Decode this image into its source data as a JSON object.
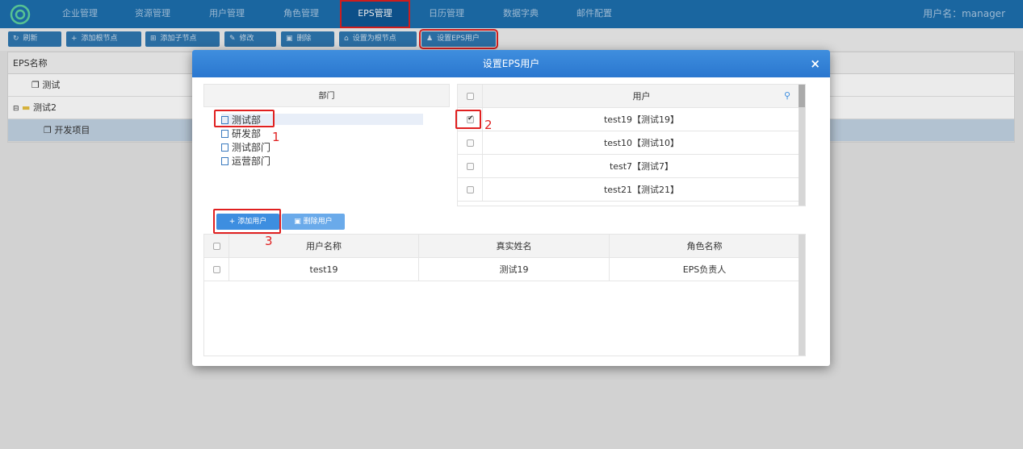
{
  "nav": {
    "items": [
      "企业管理",
      "资源管理",
      "用户管理",
      "角色管理",
      "EPS管理",
      "日历管理",
      "数据字典",
      "邮件配置"
    ],
    "active_index": 4,
    "username": "用户名：manager"
  },
  "toolbar": {
    "refresh": "刷新",
    "add_root": "添加根节点",
    "add_child": "添加子节点",
    "edit": "修改",
    "delete": "删除",
    "set_root": "设置为根节点",
    "set_eps_user": "设置EPS用户"
  },
  "tree_grid": {
    "header": "EPS名称",
    "rows": [
      "测试",
      "测试2",
      "开发项目"
    ]
  },
  "dialog": {
    "title": "设置EPS用户",
    "close": "×",
    "dept_header": "部门",
    "departments": [
      "测试部",
      "研发部",
      "测试部门",
      "运营部门"
    ],
    "user_header": "用户",
    "users": [
      "test19【测试19】",
      "test10【测试10】",
      "test7【测试7】",
      "test21【测试21】"
    ],
    "add_user": "添加用户",
    "remove_user": "删除用户",
    "assigned_headers": [
      "用户名称",
      "真实姓名",
      "角色名称"
    ],
    "assigned_rows": [
      {
        "username": "test19",
        "realname": "测试19",
        "role": "EPS负责人"
      }
    ]
  },
  "annotations": [
    "1",
    "2",
    "3"
  ],
  "colors": {
    "nav_bg": "#1d6fae",
    "accent": "#3d8ee0",
    "highlight": "#e02020"
  }
}
